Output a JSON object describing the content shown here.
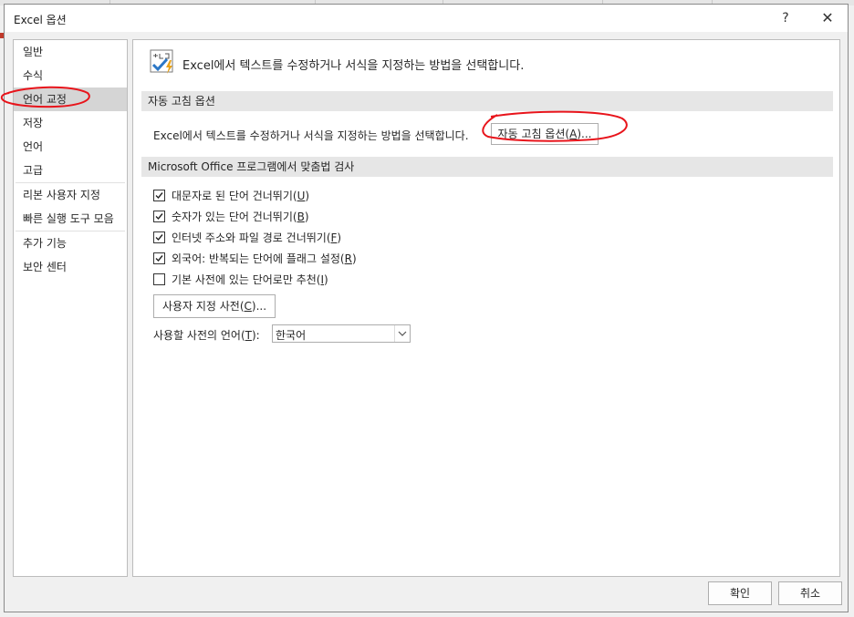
{
  "window": {
    "title": "Excel 옵션",
    "help_label": "?",
    "close_label": "✕"
  },
  "sidebar": {
    "items": [
      {
        "label": "일반"
      },
      {
        "label": "수식"
      },
      {
        "label": "언어 교정"
      },
      {
        "label": "저장"
      },
      {
        "label": "언어"
      },
      {
        "label": "고급"
      },
      {
        "label": "리본 사용자 지정"
      },
      {
        "label": "빠른 실행 도구 모음"
      },
      {
        "label": "추가 기능"
      },
      {
        "label": "보안 센터"
      }
    ],
    "selected": "언어 교정"
  },
  "main": {
    "header_text": "Excel에서 텍스트를 수정하거나 서식을 지정하는 방법을 선택합니다.",
    "autocorrect_section": {
      "title": "자동 고침 옵션",
      "description": "Excel에서 텍스트를 수정하거나 서식을 지정하는 방법을 선택합니다.",
      "button_label": "자동 고침 옵션(",
      "button_key": "A",
      "button_suffix": ")..."
    },
    "spelling_section": {
      "title": "Microsoft Office 프로그램에서 맞춤법 검사",
      "options": [
        {
          "label": "대문자로 된 단어 건너뛰기(",
          "key": "U",
          "suffix": ")",
          "checked": true
        },
        {
          "label": "숫자가 있는 단어 건너뛰기(",
          "key": "B",
          "suffix": ")",
          "checked": true
        },
        {
          "label": "인터넷 주소와 파일 경로 건너뛰기(",
          "key": "F",
          "suffix": ")",
          "checked": true
        },
        {
          "label": "외국어: 반복되는 단어에 플래그 설정(",
          "key": "R",
          "suffix": ")",
          "checked": true
        },
        {
          "label": "기본 사전에 있는 단어로만 추천(",
          "key": "I",
          "suffix": ")",
          "checked": false
        }
      ],
      "custom_dict_label": "사용자 지정 사전(",
      "custom_dict_key": "C",
      "custom_dict_suffix": ")...",
      "dict_lang_label": "사용할 사전의 언어(",
      "dict_lang_key": "T",
      "dict_lang_suffix": "):",
      "dict_lang_value": "한국어"
    }
  },
  "footer": {
    "ok_label": "확인",
    "cancel_label": "취소"
  },
  "colors": {
    "annotation": "#e8141b",
    "selected_nav": "#d5d5d5",
    "section_bar": "#e6e6e6"
  }
}
